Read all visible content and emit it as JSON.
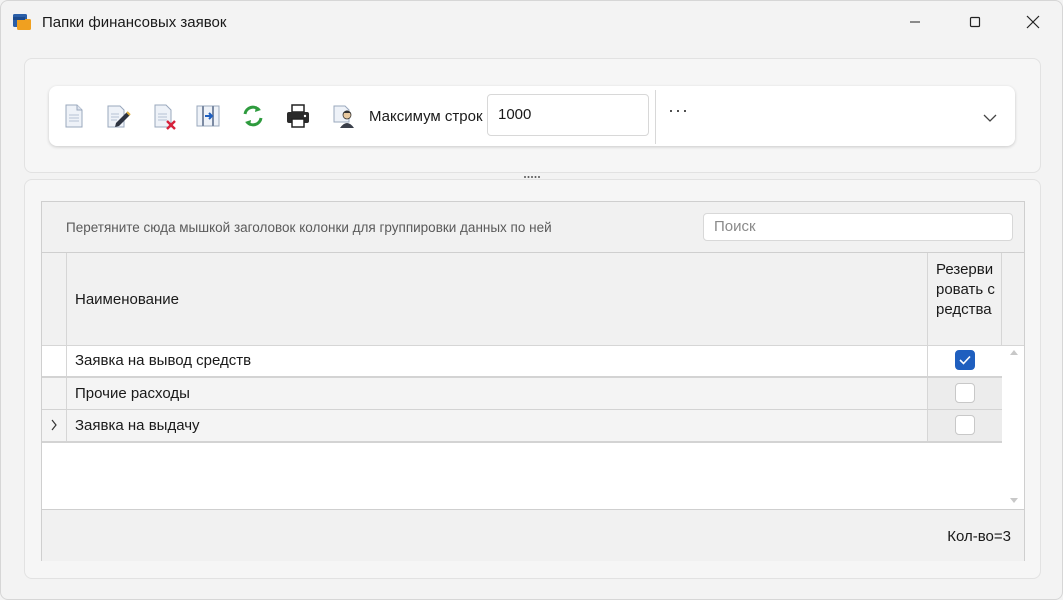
{
  "window": {
    "title": "Папки финансовых заявок",
    "controls": {
      "minimize": "minimize",
      "maximize": "maximize",
      "close": "close"
    }
  },
  "toolbar": {
    "icons": [
      "new-document-icon",
      "edit-icon",
      "delete-icon",
      "columns-icon",
      "refresh-icon",
      "print-icon",
      "user-access-icon"
    ],
    "max_rows_label": "Максимум строк",
    "max_rows_value": "1000",
    "more_label": "···"
  },
  "grid": {
    "group_hint": "Перетяните сюда мышкой заголовок колонки для группировки данных по ней",
    "search_placeholder": "Поиск",
    "columns": {
      "name": "Наименование",
      "reserve": "Резервировать средства"
    },
    "rows": [
      {
        "name": "Заявка на вывод средств",
        "reserve": true
      },
      {
        "name": "Прочие расходы",
        "reserve": false
      },
      {
        "name": "Заявка на выдачу",
        "reserve": false
      }
    ],
    "count_label": "Кол-во=3"
  },
  "colors": {
    "accent": "#1f5fbf",
    "background": "#f3f3f3",
    "refresh_green": "#2e9b3e",
    "delete_red": "#d6213a"
  }
}
